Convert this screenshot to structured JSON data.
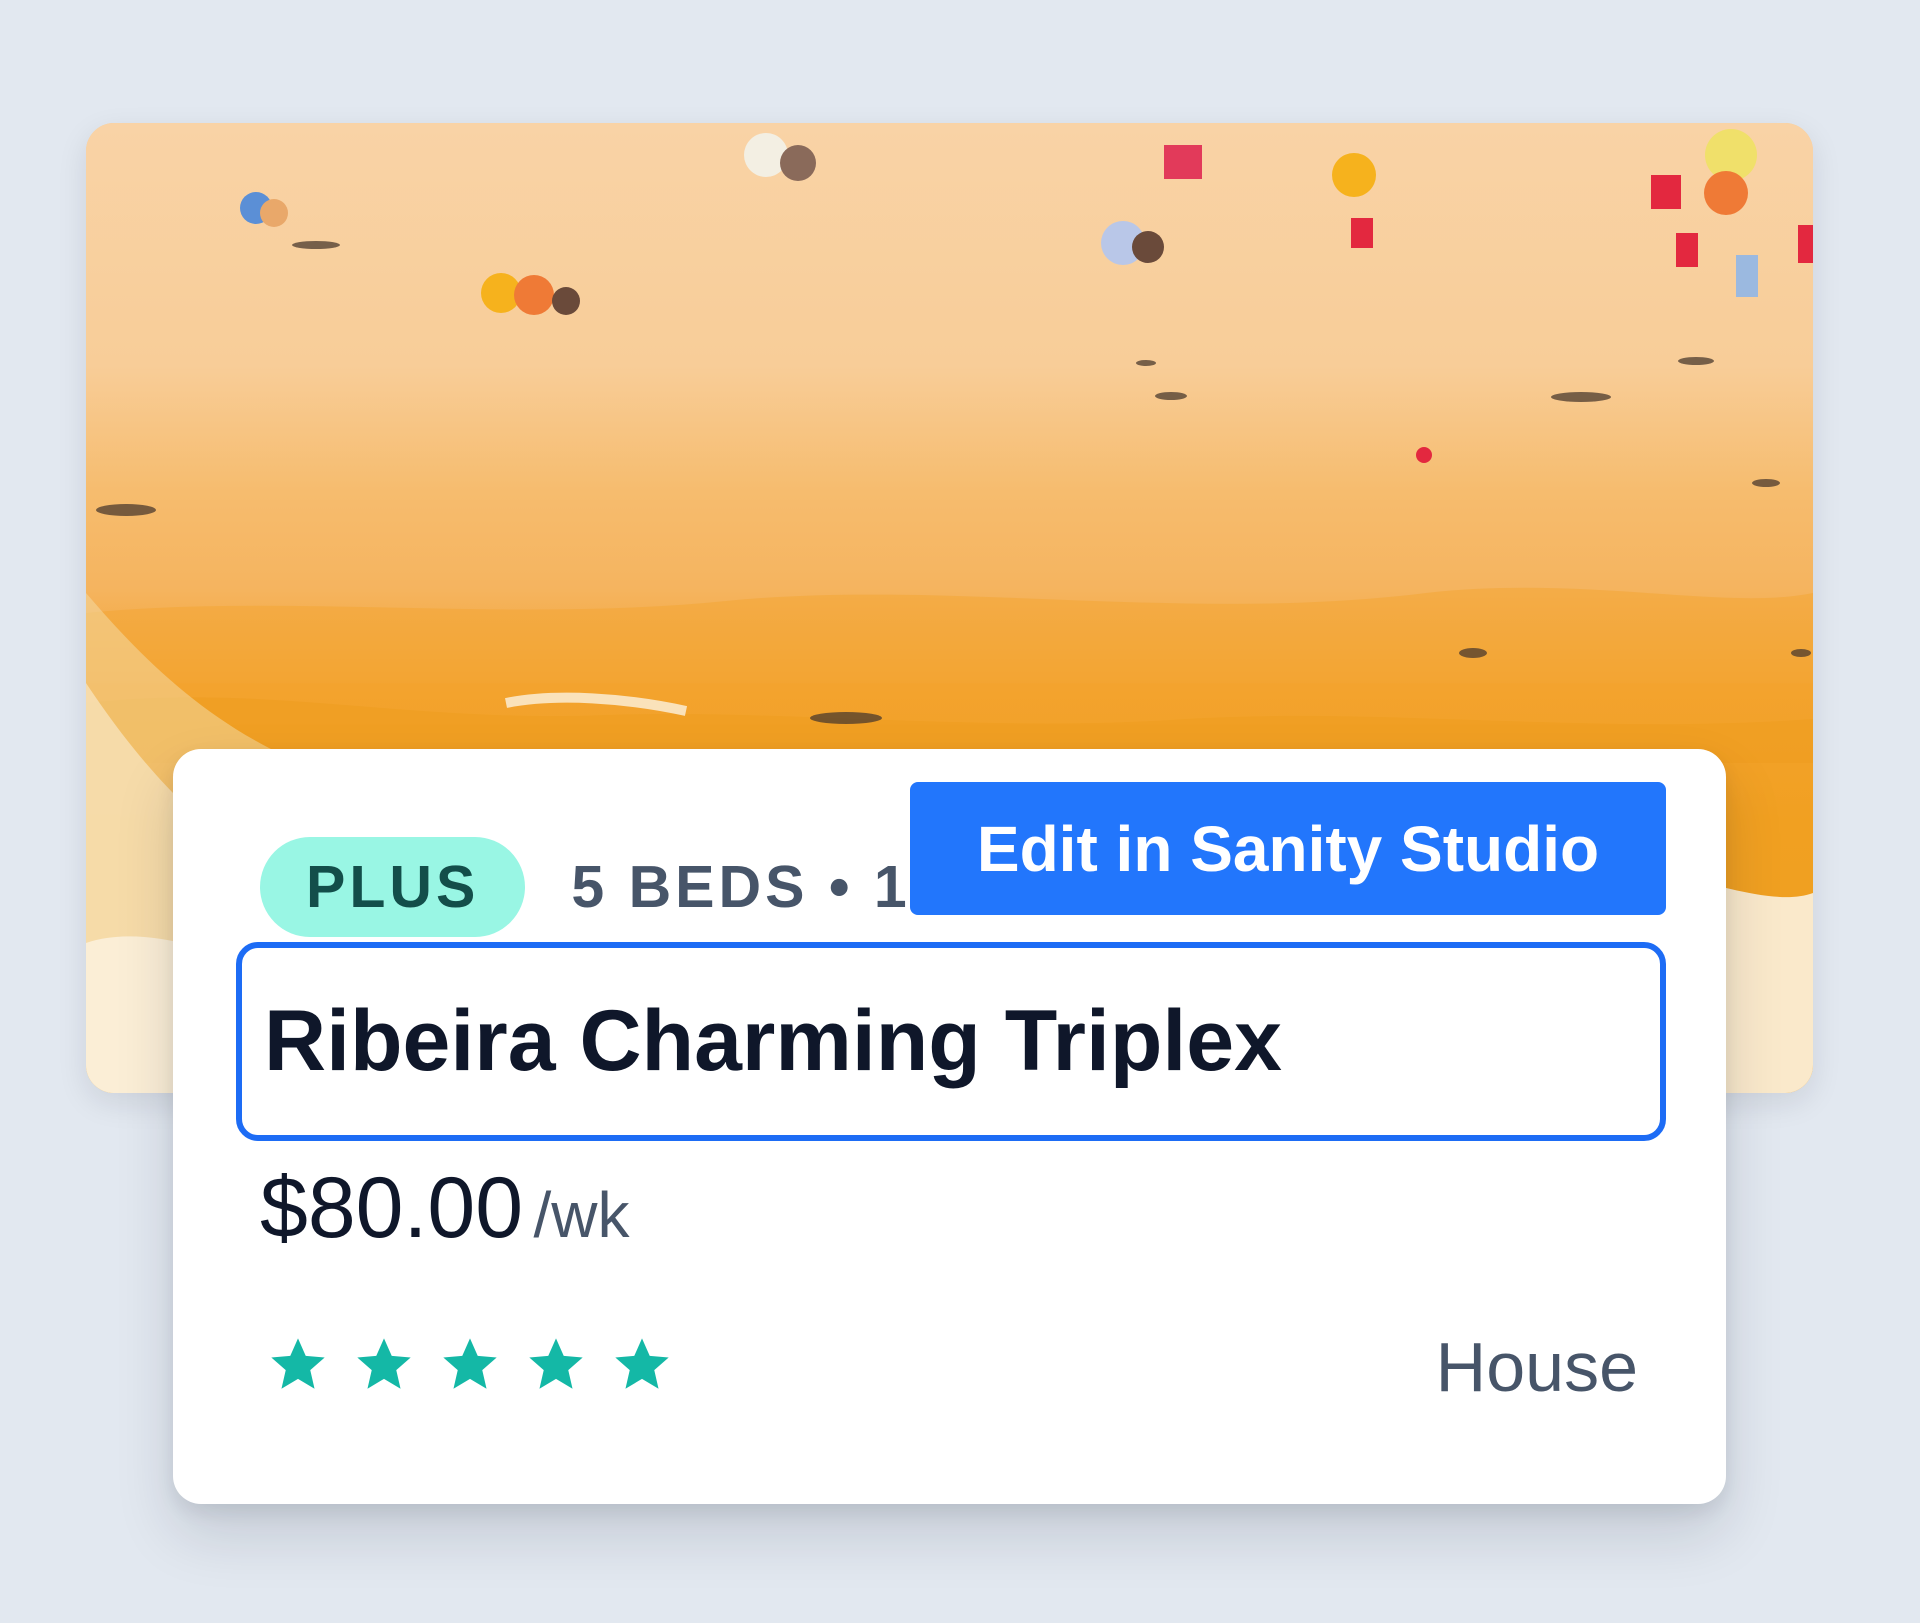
{
  "listing": {
    "badge": "PLUS",
    "beds": "5 BEDS • 1",
    "title": "Ribeira Charming Triplex",
    "price": "$80.00",
    "price_period": "/wk",
    "rating": 5,
    "rating_max": 5,
    "property_type": "House",
    "image_icon": "beach-aerial-photo"
  },
  "toolbar": {
    "edit_label": "Edit in Sanity Studio"
  },
  "colors": {
    "page_background": "#e2e8f0",
    "badge_background": "#99f6e4",
    "badge_text": "#134e4a",
    "accent_blue": "#2276fc",
    "focus_outline": "#1d6cf5",
    "star": "#14b8a6"
  }
}
